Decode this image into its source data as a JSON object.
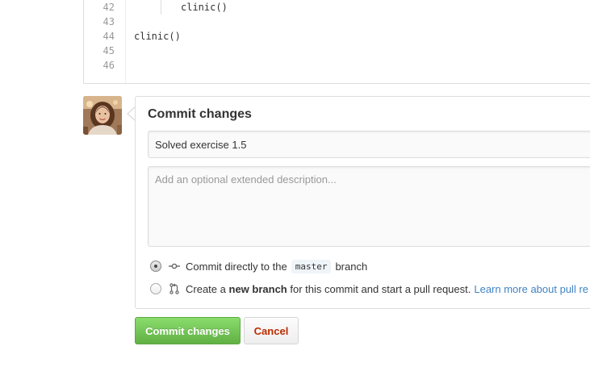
{
  "editor": {
    "lines": [
      {
        "number": "42",
        "code": "clinic()",
        "indented": true
      },
      {
        "number": "43",
        "code": "",
        "indented": false
      },
      {
        "number": "44",
        "code": "clinic()",
        "indented": false
      },
      {
        "number": "45",
        "code": "",
        "indented": false
      },
      {
        "number": "46",
        "code": "",
        "indented": false
      }
    ]
  },
  "commit": {
    "title": "Commit changes",
    "summary_value": "Solved exercise 1.5",
    "description_placeholder": "Add an optional extended description...",
    "option_direct": {
      "prefix": "Commit directly to the",
      "branch": "master",
      "suffix": "branch",
      "selected": true,
      "icon": "git-commit-icon"
    },
    "option_new_branch": {
      "prefix": "Create a",
      "bold": "new branch",
      "suffix": "for this commit and start a pull request.",
      "link": "Learn more about pull re",
      "selected": false,
      "icon": "git-pull-request-icon"
    }
  },
  "buttons": {
    "commit_label": "Commit changes",
    "cancel_label": "Cancel"
  },
  "colors": {
    "link": "#4183c4",
    "commit_button": "#60b044",
    "cancel_text": "#bd2c00"
  }
}
